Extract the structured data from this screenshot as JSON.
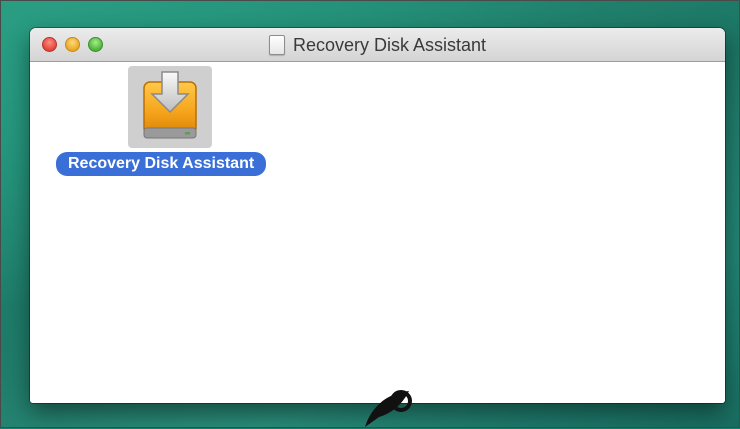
{
  "window": {
    "title": "Recovery Disk Assistant",
    "controls": {
      "close": "close-button",
      "minimize": "minimize-button",
      "zoom": "zoom-button"
    }
  },
  "content": {
    "items": [
      {
        "label": "Recovery Disk Assistant",
        "icon": "install-drive-icon",
        "selected": true
      }
    ]
  },
  "colors": {
    "selection": "#3a6fd8",
    "close": "#e0443a",
    "minimize": "#e8a825",
    "zoom": "#4ab33a",
    "drive": "#f5a21a"
  }
}
